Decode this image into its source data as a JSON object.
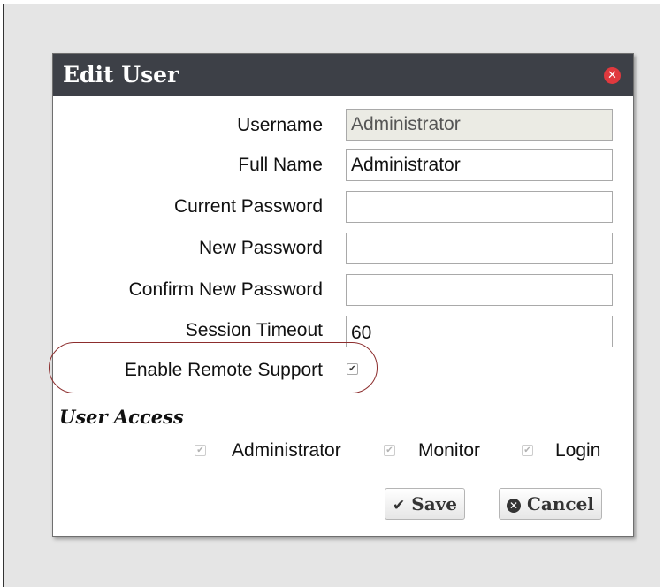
{
  "dialog": {
    "title": "Edit User",
    "close_icon": "close-icon"
  },
  "form": {
    "username": {
      "label": "Username",
      "value": "Administrator"
    },
    "full_name": {
      "label": "Full Name",
      "value": "Administrator"
    },
    "current_password": {
      "label": "Current Password",
      "value": ""
    },
    "new_password": {
      "label": "New Password",
      "value": ""
    },
    "confirm_password": {
      "label": "Confirm New Password",
      "value": ""
    },
    "session_timeout": {
      "label": "Session Timeout",
      "value": "60"
    },
    "remote_support": {
      "label": "Enable Remote Support",
      "checked": true
    }
  },
  "user_access": {
    "heading": "User Access",
    "options": [
      {
        "label": "Administrator",
        "checked": true
      },
      {
        "label": "Monitor",
        "checked": true
      },
      {
        "label": "Login",
        "checked": true
      }
    ]
  },
  "buttons": {
    "save": "Save",
    "cancel": "Cancel"
  },
  "colors": {
    "titlebar": "#3d4047",
    "close": "#e0393e",
    "highlight": "#8c2d2d"
  }
}
